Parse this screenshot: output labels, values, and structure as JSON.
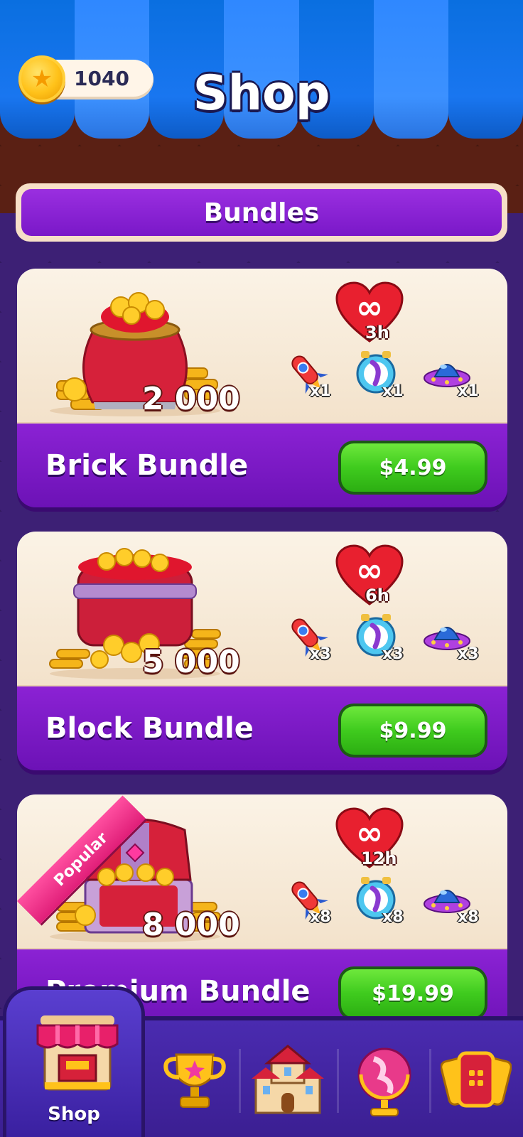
{
  "header": {
    "coins": "1040",
    "title": "Shop"
  },
  "section": {
    "label": "Bundles"
  },
  "bundles": [
    {
      "name": "Brick Bundle",
      "coins": "2 000",
      "infinite_life": "3h",
      "boosters": [
        "x1",
        "x1",
        "x1"
      ],
      "price": "$4.99"
    },
    {
      "name": "Block Bundle",
      "coins": "5 000",
      "infinite_life": "6h",
      "boosters": [
        "x3",
        "x3",
        "x3"
      ],
      "price": "$9.99"
    },
    {
      "name": "Premium Bundle",
      "coins": "8 000",
      "infinite_life": "12h",
      "boosters": [
        "x8",
        "x8",
        "x8"
      ],
      "price": "$19.99",
      "badge": "Popular"
    }
  ],
  "nav": {
    "items": [
      {
        "label": "Shop",
        "icon": "shop-icon",
        "active": true
      },
      {
        "label": "",
        "icon": "trophy-icon"
      },
      {
        "label": "",
        "icon": "castle-icon"
      },
      {
        "label": "",
        "icon": "globe-icon"
      },
      {
        "label": "",
        "icon": "cards-icon"
      }
    ]
  },
  "colors": {
    "accent_purple": "#7a18c8",
    "price_green": "#3fcb1e",
    "awning_blue": "#1976f0"
  }
}
